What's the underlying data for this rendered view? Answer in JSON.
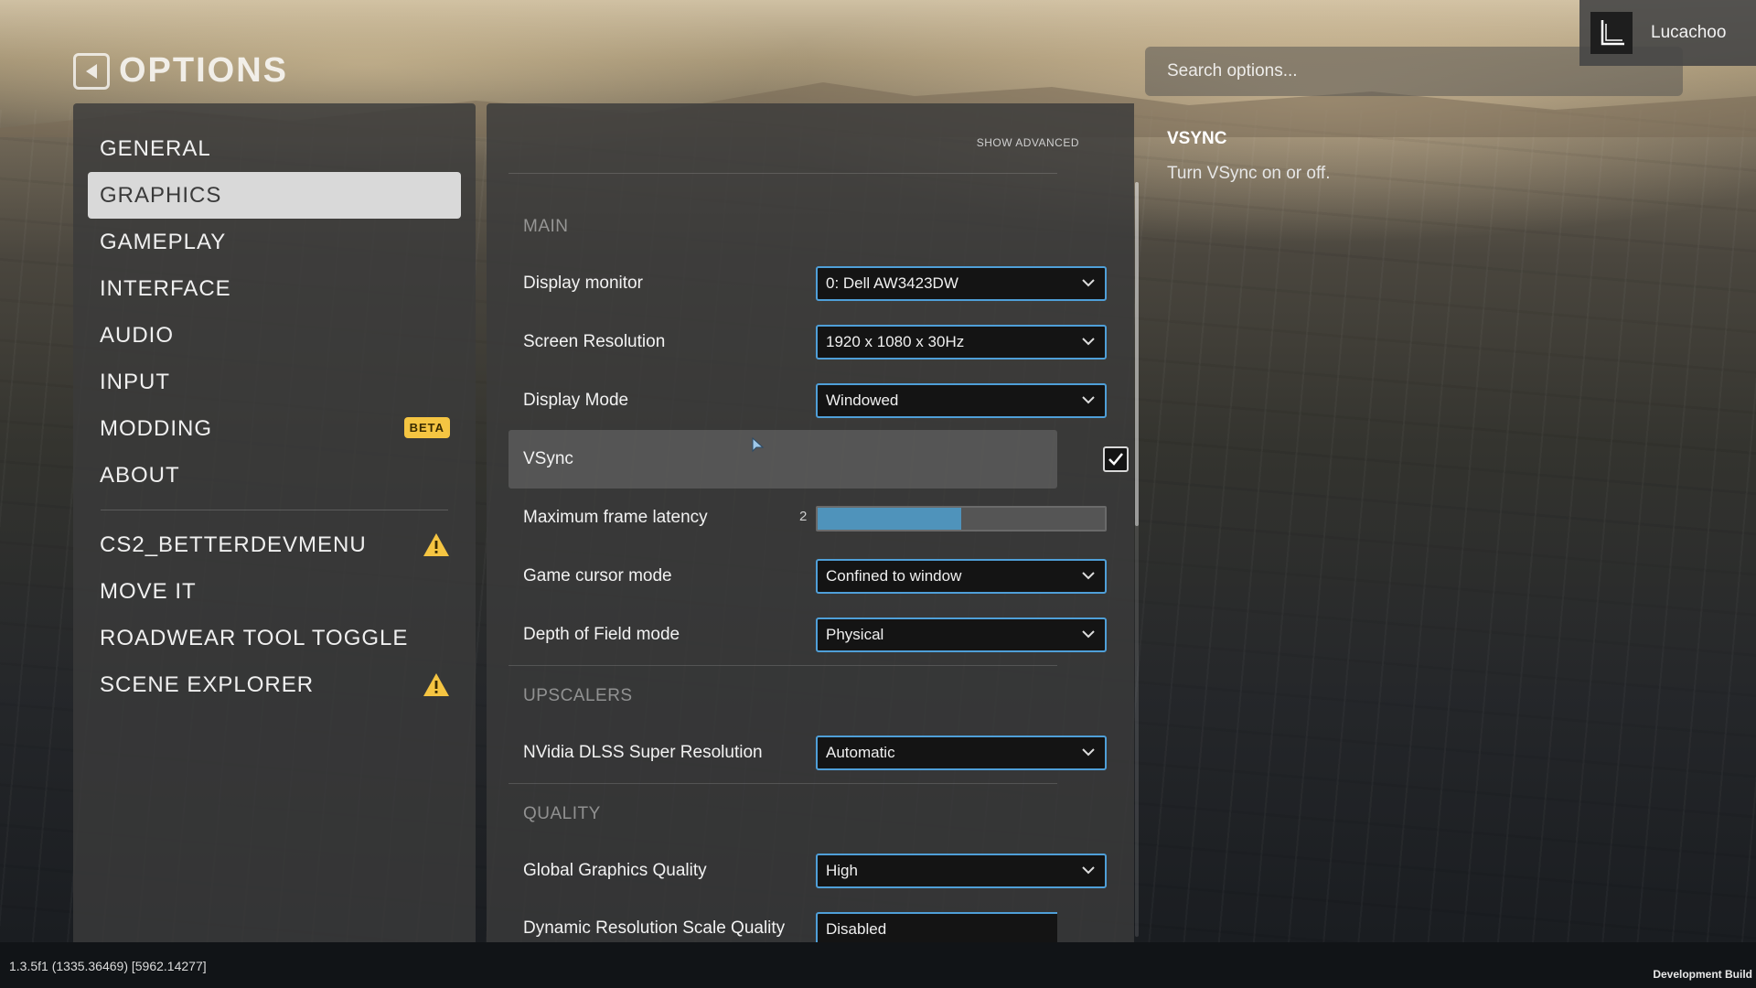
{
  "header": {
    "title": "OPTIONS",
    "search_placeholder": "Search options..."
  },
  "user": {
    "name": "Lucachoo"
  },
  "nav": {
    "items": [
      {
        "label": "GENERAL",
        "active": false
      },
      {
        "label": "GRAPHICS",
        "active": true
      },
      {
        "label": "GAMEPLAY",
        "active": false
      },
      {
        "label": "INTERFACE",
        "active": false
      },
      {
        "label": "AUDIO",
        "active": false
      },
      {
        "label": "INPUT",
        "active": false
      },
      {
        "label": "MODDING",
        "active": false,
        "badge": "BETA"
      },
      {
        "label": "ABOUT",
        "active": false
      }
    ],
    "mods": [
      {
        "label": "CS2_BETTERDEVMENU",
        "icon": "warning-icon"
      },
      {
        "label": "MOVE IT"
      },
      {
        "label": "ROADWEAR TOOL TOGGLE"
      },
      {
        "label": "SCENE EXPLORER",
        "icon": "warning-icon"
      }
    ]
  },
  "settings": {
    "show_advanced": "SHOW ADVANCED",
    "sections": {
      "main": "MAIN",
      "upscalers": "UPSCALERS",
      "quality": "QUALITY"
    },
    "rows": {
      "display_monitor": {
        "label": "Display monitor",
        "value": "0: Dell AW3423DW"
      },
      "screen_resolution": {
        "label": "Screen Resolution",
        "value": "1920 x 1080 x 30Hz"
      },
      "display_mode": {
        "label": "Display Mode",
        "value": "Windowed"
      },
      "vsync": {
        "label": "VSync",
        "checked": true
      },
      "max_frame_latency": {
        "label": "Maximum frame latency",
        "value": "2",
        "fill_fraction": 0.5
      },
      "cursor_mode": {
        "label": "Game cursor mode",
        "value": "Confined to window"
      },
      "dof_mode": {
        "label": "Depth of Field mode",
        "value": "Physical"
      },
      "dlss": {
        "label": "NVidia DLSS Super Resolution",
        "value": "Automatic"
      },
      "global_quality": {
        "label": "Global Graphics Quality",
        "value": "High"
      },
      "dynamic_res": {
        "label": "Dynamic Resolution Scale Quality",
        "value": "Disabled"
      }
    }
  },
  "description": {
    "title": "VSYNC",
    "text": "Turn VSync on or off."
  },
  "footer": {
    "version": "1.3.5f1 (1335.36469) [5962.14277]",
    "build": "Development Build"
  },
  "colors": {
    "accent": "#4f9fd8",
    "slider_fill": "#4f93bb",
    "beta_badge": "#f5c542",
    "warning": "#f5c542"
  }
}
